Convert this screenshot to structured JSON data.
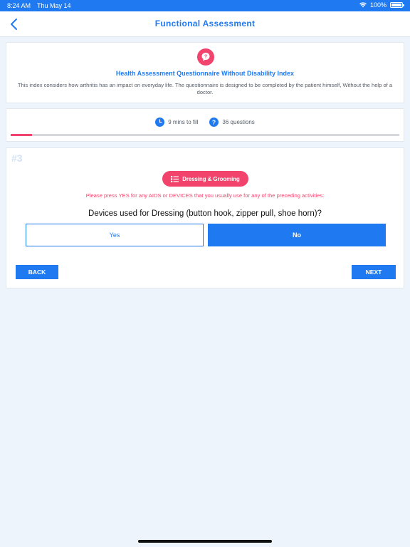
{
  "status_bar": {
    "time": "8:24 AM",
    "date": "Thu May 14",
    "battery": "100%"
  },
  "nav": {
    "title": "Functional Assessment",
    "back_icon": "chevron-left-icon"
  },
  "info": {
    "icon": "question-mark-icon",
    "title": "Health Assessment Questionnaire Without Disability Index",
    "description": "This index considers how arthritis has an impact on everyday life. The questionnaire is designed to be completed by the patient himself, Without the help of a doctor."
  },
  "meta": {
    "time_label": "9 mins to fill",
    "questions_label": "36 questions",
    "progress_fraction": 0.055
  },
  "question": {
    "number": "#3",
    "category": "Dressing & Grooming",
    "instruction": "Please press YES for any AIDS or DEVICES that you usually use for any of the preceding activities:",
    "text": "Devices used for Dressing (button hook, zipper pull, shoe horn)?",
    "options": [
      "Yes",
      "No"
    ],
    "selected": "No"
  },
  "actions": {
    "back_label": "BACK",
    "next_label": "NEXT"
  },
  "colors": {
    "accent": "#1f7af2",
    "pink": "#f2436c",
    "background": "#eef4fc"
  }
}
